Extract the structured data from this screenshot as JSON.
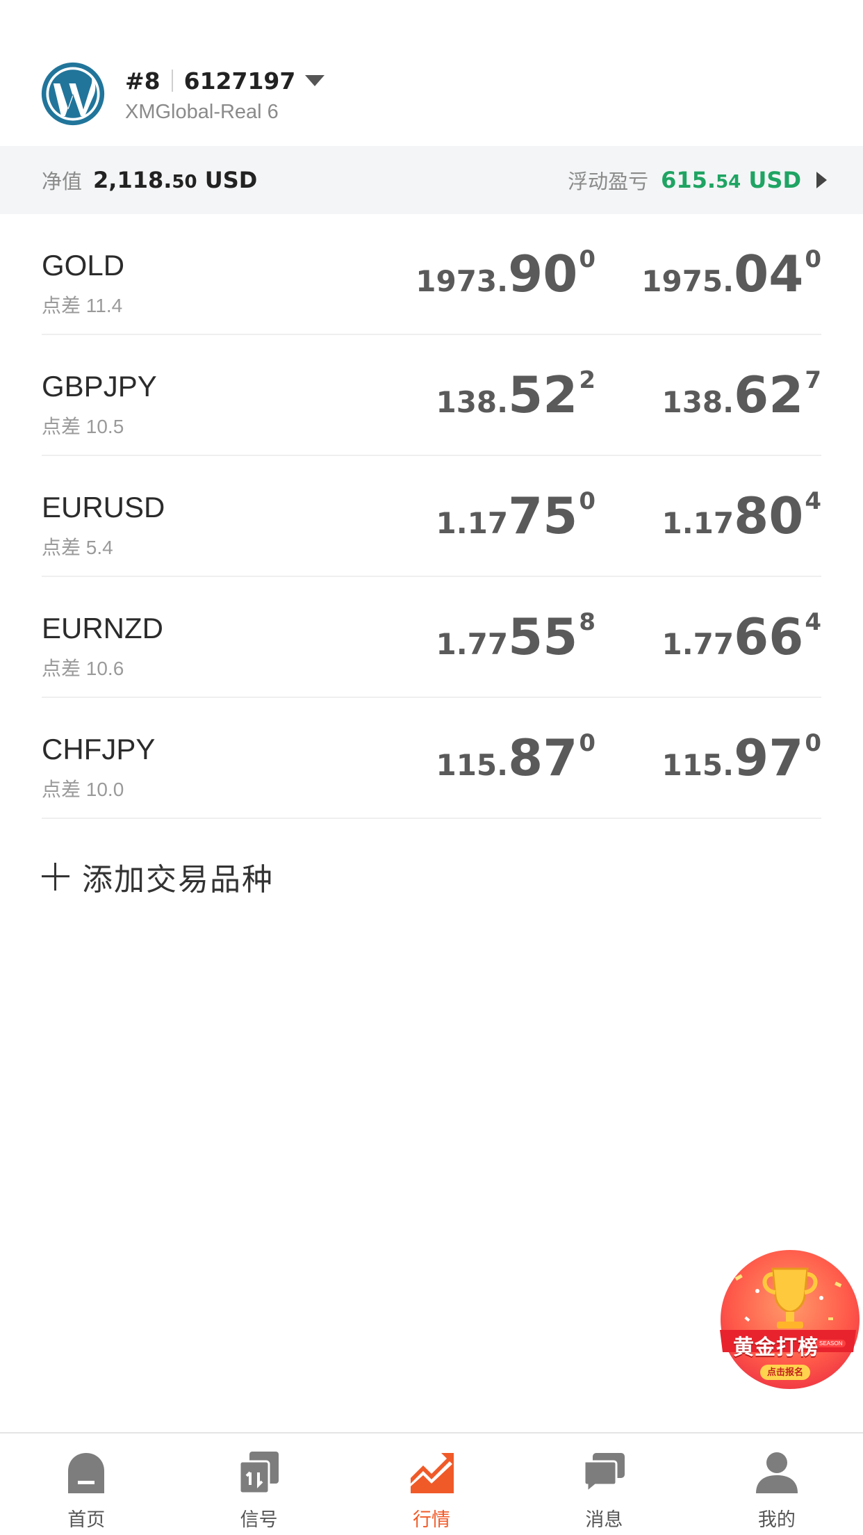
{
  "account": {
    "index": "#8",
    "number": "6127197",
    "server": "XMGlobal-Real 6"
  },
  "equity": {
    "label": "净值",
    "value_main": "2,118.",
    "value_small": "50",
    "currency": " USD"
  },
  "floating_pl": {
    "label": "浮动盈亏",
    "value_main": "615.",
    "value_small": "54",
    "currency": " USD",
    "color": "#1fa463"
  },
  "quotes": [
    {
      "symbol": "GOLD",
      "spread": "点差 11.4",
      "bid": {
        "head": "1973.",
        "big": "90",
        "sup": "0"
      },
      "ask": {
        "head": "1975.",
        "big": "04",
        "sup": "0"
      }
    },
    {
      "symbol": "GBPJPY",
      "spread": "点差 10.5",
      "bid": {
        "head": "138.",
        "big": "52",
        "sup": "2"
      },
      "ask": {
        "head": "138.",
        "big": "62",
        "sup": "7"
      }
    },
    {
      "symbol": "EURUSD",
      "spread": "点差 5.4",
      "bid": {
        "head": "1.17",
        "big": "75",
        "sup": "0"
      },
      "ask": {
        "head": "1.17",
        "big": "80",
        "sup": "4"
      }
    },
    {
      "symbol": "EURNZD",
      "spread": "点差 10.6",
      "bid": {
        "head": "1.77",
        "big": "55",
        "sup": "8"
      },
      "ask": {
        "head": "1.77",
        "big": "66",
        "sup": "4"
      }
    },
    {
      "symbol": "CHFJPY",
      "spread": "点差 10.0",
      "bid": {
        "head": "115.",
        "big": "87",
        "sup": "0"
      },
      "ask": {
        "head": "115.",
        "big": "97",
        "sup": "0"
      }
    }
  ],
  "add_symbol": {
    "label": "添加交易品种"
  },
  "promo": {
    "title": "黄金打榜",
    "subtitle": "点击报名",
    "season": "SEASON"
  },
  "nav": {
    "items": [
      {
        "label": "首页",
        "icon": "home-icon"
      },
      {
        "label": "信号",
        "icon": "signal-icon"
      },
      {
        "label": "行情",
        "icon": "market-chart-icon",
        "active": true
      },
      {
        "label": "消息",
        "icon": "message-icon"
      },
      {
        "label": "我的",
        "icon": "profile-icon"
      }
    ]
  },
  "colors": {
    "brand_blue": "#21759b",
    "active": "#f05a28",
    "positive": "#1fa463",
    "price_text": "#5a5a5a"
  }
}
